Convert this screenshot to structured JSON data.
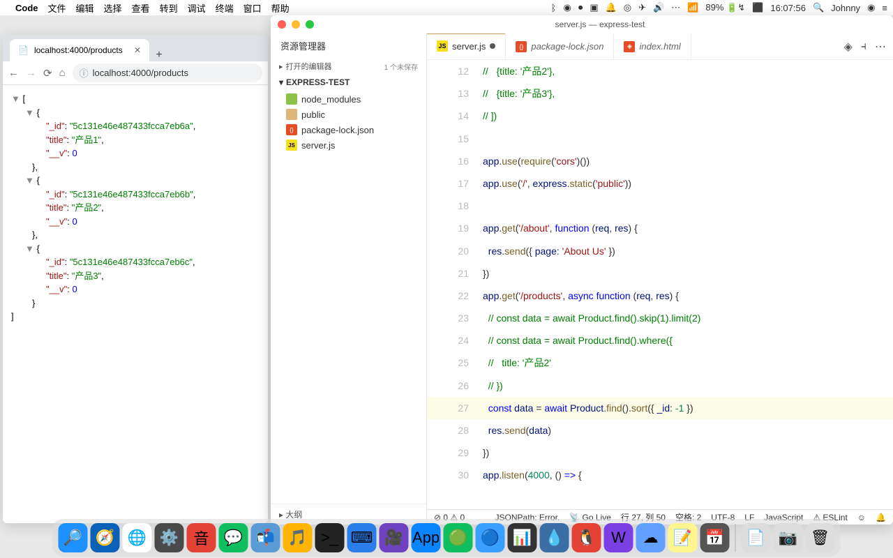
{
  "menubar": {
    "app": "Code",
    "items": [
      "文件",
      "编辑",
      "选择",
      "查看",
      "转到",
      "调试",
      "终端",
      "窗口",
      "帮助"
    ],
    "battery": "89%",
    "clock": "16:07:56",
    "user": "Johnny"
  },
  "chrome": {
    "tab_title": "localhost:4000/products",
    "url": "localhost:4000/products",
    "json": [
      {
        "_id": "5c131e46e487433fcca7eb6a",
        "title": "产品1",
        "__v": 0
      },
      {
        "_id": "5c131e46e487433fcca7eb6b",
        "title": "产品2",
        "__v": 0
      },
      {
        "_id": "5c131e46e487433fcca7eb6c",
        "title": "产品3",
        "__v": 0
      }
    ]
  },
  "vscode": {
    "title": "server.js — express-test",
    "explorer_title": "资源管理器",
    "open_editors": "打开的编辑器",
    "unsaved_badge": "1 个未保存",
    "project": "EXPRESS-TEST",
    "tree": [
      {
        "kind": "folder-green",
        "label": "node_modules"
      },
      {
        "kind": "folder",
        "label": "public"
      },
      {
        "kind": "json",
        "label": "package-lock.json"
      },
      {
        "kind": "js",
        "label": "server.js"
      }
    ],
    "outline": "大纲",
    "tabs": [
      {
        "icon": "js",
        "label": "server.js",
        "active": true,
        "dirty": true
      },
      {
        "icon": "json",
        "label": "package-lock.json",
        "active": false
      },
      {
        "icon": "html",
        "label": "index.html",
        "active": false
      }
    ],
    "code": [
      {
        "n": 12,
        "tokens": [
          [
            "cm",
            "//   {title: '产品2'},"
          ]
        ]
      },
      {
        "n": 13,
        "tokens": [
          [
            "cm",
            "//   {title: '产品3'},"
          ]
        ]
      },
      {
        "n": 14,
        "tokens": [
          [
            "cm",
            "// ])"
          ]
        ]
      },
      {
        "n": 15,
        "tokens": []
      },
      {
        "n": 16,
        "tokens": [
          [
            "var",
            "app"
          ],
          [
            "op",
            "."
          ],
          [
            "fn",
            "use"
          ],
          [
            "op",
            "("
          ],
          [
            "fn",
            "require"
          ],
          [
            "op",
            "("
          ],
          [
            "str",
            "'cors'"
          ],
          [
            "op",
            ")())"
          ]
        ]
      },
      {
        "n": 17,
        "tokens": [
          [
            "var",
            "app"
          ],
          [
            "op",
            "."
          ],
          [
            "fn",
            "use"
          ],
          [
            "op",
            "("
          ],
          [
            "str",
            "'/'"
          ],
          [
            "op",
            ", "
          ],
          [
            "var",
            "express"
          ],
          [
            "op",
            "."
          ],
          [
            "fn",
            "static"
          ],
          [
            "op",
            "("
          ],
          [
            "str",
            "'public'"
          ],
          [
            "op",
            "))"
          ]
        ]
      },
      {
        "n": 18,
        "tokens": []
      },
      {
        "n": 19,
        "tokens": [
          [
            "var",
            "app"
          ],
          [
            "op",
            "."
          ],
          [
            "fn",
            "get"
          ],
          [
            "op",
            "("
          ],
          [
            "str",
            "'/about'"
          ],
          [
            "op",
            ", "
          ],
          [
            "kw",
            "function"
          ],
          [
            "op",
            " ("
          ],
          [
            "var",
            "req"
          ],
          [
            "op",
            ", "
          ],
          [
            "var",
            "res"
          ],
          [
            "op",
            ") {"
          ]
        ]
      },
      {
        "n": 20,
        "tokens": [
          [
            "op",
            "  "
          ],
          [
            "var",
            "res"
          ],
          [
            "op",
            "."
          ],
          [
            "fn",
            "send"
          ],
          [
            "op",
            "({ "
          ],
          [
            "var",
            "page"
          ],
          [
            "op",
            ": "
          ],
          [
            "str",
            "'About Us'"
          ],
          [
            "op",
            " })"
          ]
        ]
      },
      {
        "n": 21,
        "tokens": [
          [
            "op",
            "})"
          ]
        ]
      },
      {
        "n": 22,
        "tokens": [
          [
            "var",
            "app"
          ],
          [
            "op",
            "."
          ],
          [
            "fn",
            "get"
          ],
          [
            "op",
            "("
          ],
          [
            "str",
            "'/products'"
          ],
          [
            "op",
            ", "
          ],
          [
            "kw",
            "async"
          ],
          [
            "op",
            " "
          ],
          [
            "kw",
            "function"
          ],
          [
            "op",
            " ("
          ],
          [
            "var",
            "req"
          ],
          [
            "op",
            ", "
          ],
          [
            "var",
            "res"
          ],
          [
            "op",
            ") {"
          ]
        ]
      },
      {
        "n": 23,
        "tokens": [
          [
            "op",
            "  "
          ],
          [
            "cm",
            "// const data = await Product.find().skip(1).limit(2)"
          ]
        ]
      },
      {
        "n": 24,
        "tokens": [
          [
            "op",
            "  "
          ],
          [
            "cm",
            "// const data = await Product.find().where({"
          ]
        ]
      },
      {
        "n": 25,
        "tokens": [
          [
            "op",
            "  "
          ],
          [
            "cm",
            "//   title: '产品2'"
          ]
        ]
      },
      {
        "n": 26,
        "tokens": [
          [
            "op",
            "  "
          ],
          [
            "cm",
            "// })"
          ]
        ]
      },
      {
        "n": 27,
        "hl": true,
        "tokens": [
          [
            "op",
            "  "
          ],
          [
            "kw",
            "const"
          ],
          [
            "op",
            " "
          ],
          [
            "var",
            "data"
          ],
          [
            "op",
            " = "
          ],
          [
            "kw",
            "await"
          ],
          [
            "op",
            " "
          ],
          [
            "var",
            "Product"
          ],
          [
            "op",
            "."
          ],
          [
            "fn",
            "find"
          ],
          [
            "op",
            "()."
          ],
          [
            "fn",
            "sort"
          ],
          [
            "op",
            "({ "
          ],
          [
            "var",
            "_id"
          ],
          [
            "op",
            ": "
          ],
          [
            "num",
            "-1"
          ],
          [
            "op",
            " })"
          ]
        ]
      },
      {
        "n": 28,
        "tokens": [
          [
            "op",
            "  "
          ],
          [
            "var",
            "res"
          ],
          [
            "op",
            "."
          ],
          [
            "fn",
            "send"
          ],
          [
            "op",
            "("
          ],
          [
            "var",
            "data"
          ],
          [
            "op",
            ")"
          ]
        ]
      },
      {
        "n": 29,
        "tokens": [
          [
            "op",
            "})"
          ]
        ]
      },
      {
        "n": 30,
        "tokens": [
          [
            "var",
            "app"
          ],
          [
            "op",
            "."
          ],
          [
            "fn",
            "listen"
          ],
          [
            "op",
            "("
          ],
          [
            "num",
            "4000"
          ],
          [
            "op",
            ", () "
          ],
          [
            "kw",
            "=>"
          ],
          [
            "op",
            " {"
          ]
        ]
      }
    ],
    "status": {
      "errors": "0",
      "warnings": "0",
      "jsonpath": "JSONPath: Error.",
      "golive": "Go Live",
      "ln_col": "行 27, 列 50",
      "spaces": "空格: 2",
      "encoding": "UTF-8",
      "eol": "LF",
      "lang": "JavaScript",
      "eslint": "ESLint"
    }
  },
  "dock_apps": [
    {
      "bg": "#1e90ff",
      "e": "🔎"
    },
    {
      "bg": "#0b61b8",
      "e": "🧭"
    },
    {
      "bg": "#fff",
      "e": "🌐"
    },
    {
      "bg": "#4a4a4a",
      "e": "⚙️"
    },
    {
      "bg": "#e34234",
      "e": "音"
    },
    {
      "bg": "#0fbf5f",
      "e": "💬"
    },
    {
      "bg": "#5b9bd5",
      "e": "📬"
    },
    {
      "bg": "#ffb400",
      "e": "🎵"
    },
    {
      "bg": "#222",
      "e": ">_"
    },
    {
      "bg": "#2b7de9",
      "e": "⌨"
    },
    {
      "bg": "#6f42c1",
      "e": "🎥"
    },
    {
      "bg": "#0a84ff",
      "e": "App"
    },
    {
      "bg": "#0fbf5f",
      "e": "🟢"
    },
    {
      "bg": "#3aa0ff",
      "e": "🔵"
    },
    {
      "bg": "#333",
      "e": "📊"
    },
    {
      "bg": "#3a6ea5",
      "e": "💧"
    },
    {
      "bg": "#e34234",
      "e": "🐧"
    },
    {
      "bg": "#7b3fe4",
      "e": "W"
    },
    {
      "bg": "#61a0ff",
      "e": "☁"
    },
    {
      "bg": "#fff68f",
      "e": "📝"
    },
    {
      "bg": "#555",
      "e": "📅"
    }
  ],
  "dock_right": [
    {
      "bg": "#ddd",
      "e": "📄"
    },
    {
      "bg": "#ddd",
      "e": "📷"
    },
    {
      "bg": "#ddd",
      "e": "🗑"
    }
  ]
}
